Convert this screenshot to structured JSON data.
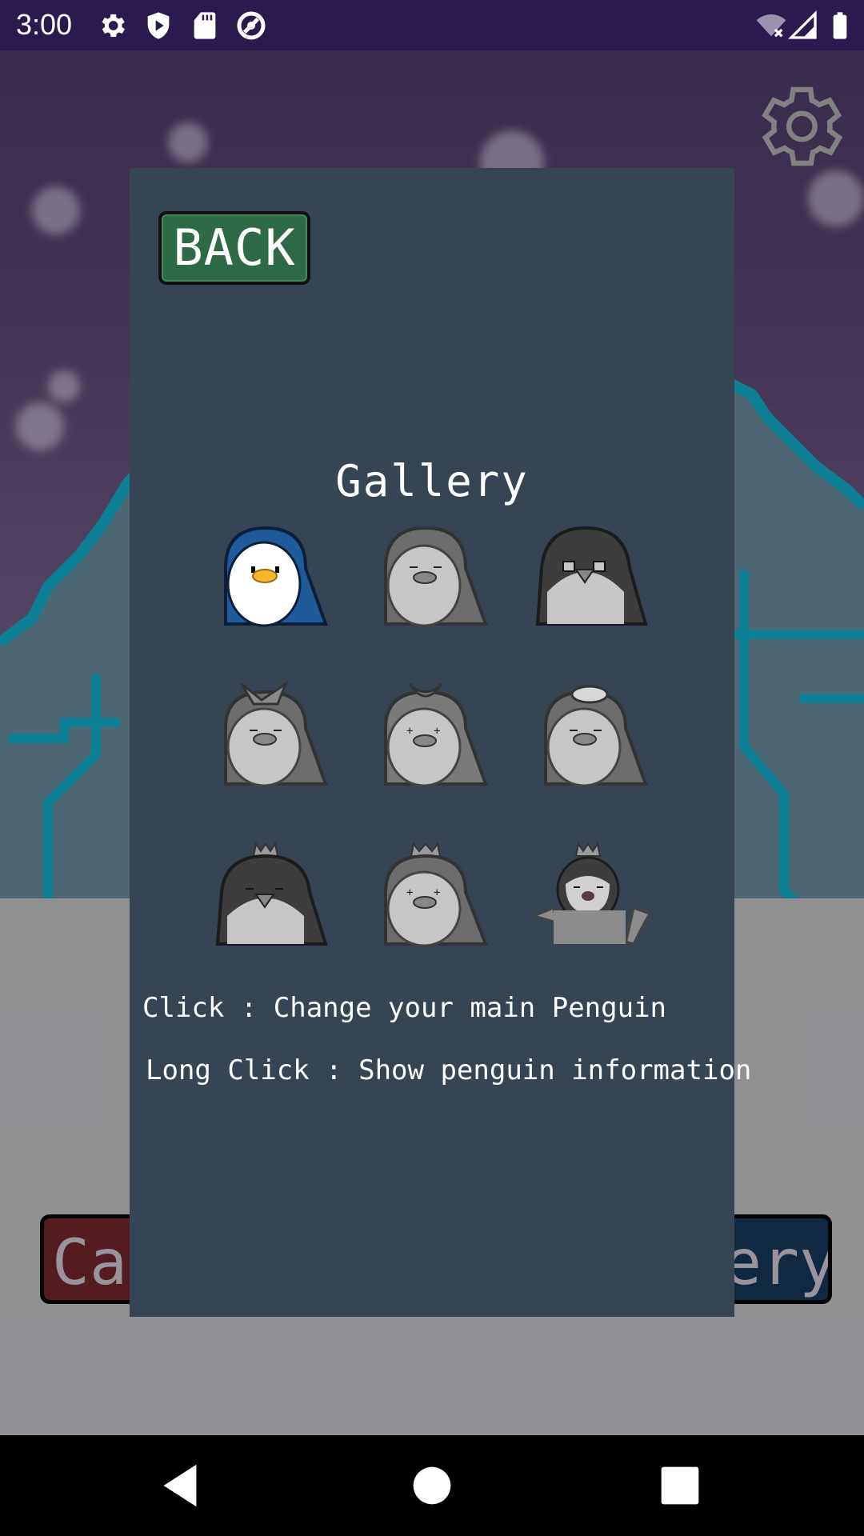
{
  "status_bar": {
    "time": "3:00",
    "icons": [
      "gear-icon",
      "shield-play-icon",
      "sd-card-icon",
      "do-not-disturb-icon"
    ],
    "right_icons": [
      "wifi-off-icon",
      "signal-icon",
      "battery-icon"
    ]
  },
  "background": {
    "bottom_left_button_label": "Cale",
    "bottom_right_button_label": "ery",
    "settings_icon": "gear-icon"
  },
  "dialog": {
    "back_label": "BACK",
    "title": "Gallery",
    "penguins": [
      {
        "name": "blue-hooded-penguin",
        "unlocked": true
      },
      {
        "name": "gray-hooded-penguin",
        "unlocked": false
      },
      {
        "name": "dark-round-penguin",
        "unlocked": false
      },
      {
        "name": "ribbon-penguin",
        "unlocked": false
      },
      {
        "name": "sparkle-bow-penguin",
        "unlocked": false
      },
      {
        "name": "sailor-hat-penguin",
        "unlocked": false
      },
      {
        "name": "crown-dark-penguin",
        "unlocked": false
      },
      {
        "name": "crown-gray-penguin",
        "unlocked": false
      },
      {
        "name": "crown-baby-penguin",
        "unlocked": false
      }
    ],
    "hint_click": "Click : Change your main Penguin",
    "hint_long_click": "Long Click : Show penguin information"
  },
  "colors": {
    "dialog_bg": "#364453",
    "back_button": "#2e6a48",
    "glacier_line": "#0a8aa0"
  }
}
